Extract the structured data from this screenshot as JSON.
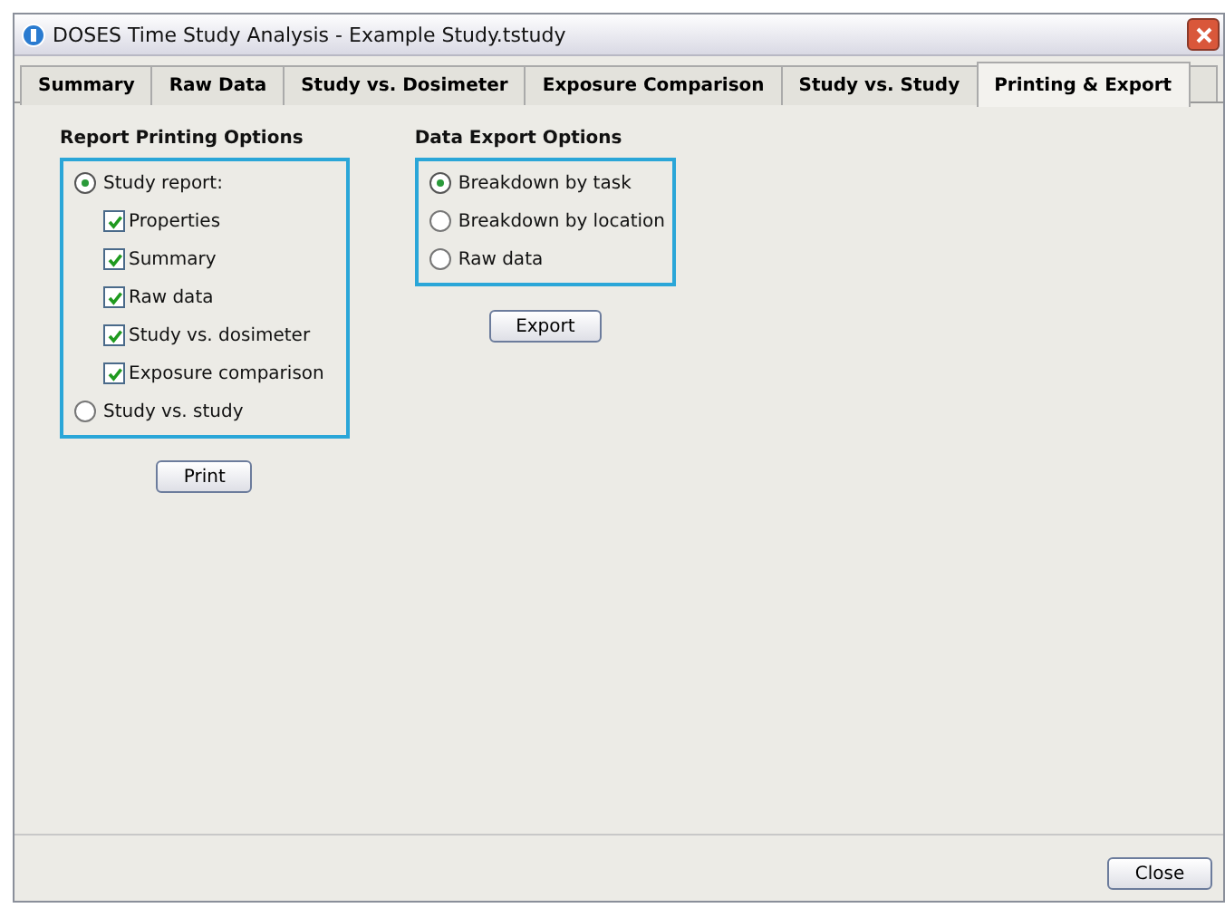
{
  "window": {
    "title": "DOSES Time Study Analysis - Example Study.tstudy"
  },
  "tabs": [
    {
      "label": "Summary",
      "selected": false
    },
    {
      "label": "Raw Data",
      "selected": false
    },
    {
      "label": "Study vs. Dosimeter",
      "selected": false
    },
    {
      "label": "Exposure Comparison",
      "selected": false
    },
    {
      "label": "Study vs. Study",
      "selected": false
    },
    {
      "label": "Printing & Export",
      "selected": true
    }
  ],
  "report_printing": {
    "title": "Report Printing Options",
    "options": [
      {
        "label": "Study report:",
        "selected": true,
        "items": [
          {
            "label": "Properties",
            "checked": true
          },
          {
            "label": "Summary",
            "checked": true
          },
          {
            "label": "Raw data",
            "checked": true
          },
          {
            "label": "Study vs. dosimeter",
            "checked": true
          },
          {
            "label": "Exposure comparison",
            "checked": true
          }
        ]
      },
      {
        "label": "Study vs. study",
        "selected": false
      }
    ],
    "button": "Print"
  },
  "data_export": {
    "title": "Data Export Options",
    "options": [
      {
        "label": "Breakdown by task",
        "selected": true
      },
      {
        "label": "Breakdown by location",
        "selected": false
      },
      {
        "label": "Raw data",
        "selected": false
      }
    ],
    "button": "Export"
  },
  "footer": {
    "button": "Close"
  }
}
